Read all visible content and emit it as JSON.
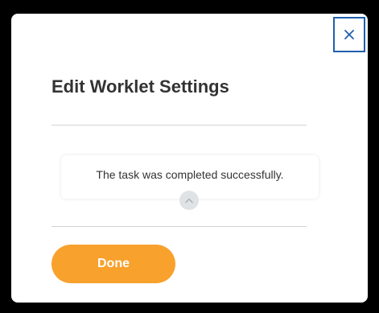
{
  "dialog": {
    "title": "Edit Worklet Settings",
    "message": "The task was completed successfully.",
    "done_label": "Done",
    "close_icon": "close-icon",
    "collapse_icon": "chevron-up-icon"
  },
  "colors": {
    "accent": "#f8a12c",
    "focus_border": "#1f5fad",
    "text": "#333333",
    "divider": "#d3d3d3",
    "collapse_bg": "#dfe3e6"
  }
}
